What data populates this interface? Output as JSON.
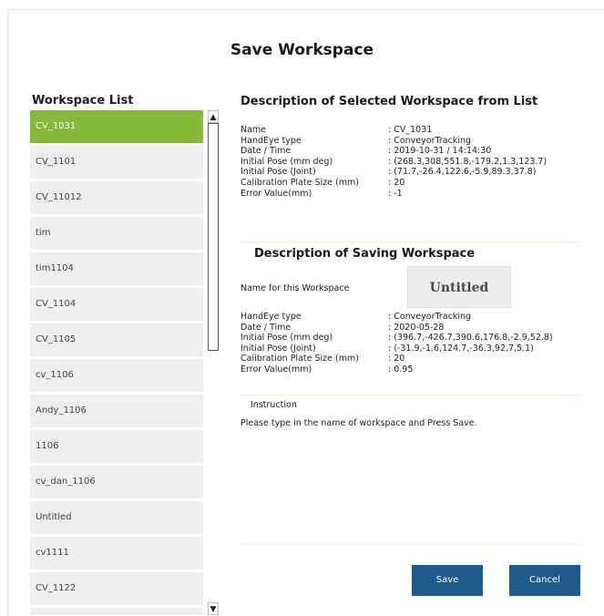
{
  "dialog": {
    "title": "Save Workspace"
  },
  "workspace_list": {
    "title": "Workspace List",
    "items": [
      {
        "label": "CV_1031",
        "selected": true
      },
      {
        "label": "CV_1101"
      },
      {
        "label": "CV_11012"
      },
      {
        "label": "tim"
      },
      {
        "label": "tim1104"
      },
      {
        "label": "CV_1104"
      },
      {
        "label": "CV_1105"
      },
      {
        "label": "cv_1106"
      },
      {
        "label": "Andy_1106"
      },
      {
        "label": "1106"
      },
      {
        "label": "cv_dan_1106"
      },
      {
        "label": "Untitled"
      },
      {
        "label": "cv1111"
      },
      {
        "label": "CV_1122"
      }
    ],
    "scroll_up_icon": "triangle-up",
    "scroll_down_icon": "triangle-down"
  },
  "selected_desc": {
    "title": "Description of Selected Workspace from List",
    "rows": [
      {
        "k": "Name",
        "v": ": CV_1031"
      },
      {
        "k": "HandEye type",
        "v": ": ConveyorTracking"
      },
      {
        "k": "Date / Time",
        "v": ": 2019-10-31 / 14:14:30"
      },
      {
        "k": "Initial Pose (mm deg)",
        "v": ": (268.3,308,551.8,-179.2,1.3,123.7)"
      },
      {
        "k": "Initial Pose (Joint)",
        "v": ": (71.7,-26.4,122.6,-5.9,89.3,37.8)"
      },
      {
        "k": "Calibration Plate Size (mm)",
        "v": ": 20"
      },
      {
        "k": "Error Value(mm)",
        "v": ": -1"
      }
    ]
  },
  "saving_desc": {
    "title": "Description of Saving Workspace",
    "name_label": "Name for this Workspace",
    "name_value": "Untitled",
    "rows": [
      {
        "k": "HandEye type",
        "v": ": ConveyorTracking"
      },
      {
        "k": "Date / Time",
        "v": ": 2020-05-28"
      },
      {
        "k": "Initial Pose (mm deg)",
        "v": ": (396.7,-426.7,390.6,176.8,-2.9,52.8)"
      },
      {
        "k": "Initial Pose (Joint)",
        "v": ": (-31.9,-1.6,124.7,-36.3,92.7,5.1)"
      },
      {
        "k": "Calibration Plate Size (mm)",
        "v": ": 20"
      },
      {
        "k": "Error Value(mm)",
        "v": ": 0.95"
      }
    ]
  },
  "instruction": {
    "label": "Instruction",
    "text": "Please type in the name of workspace and Press Save."
  },
  "buttons": {
    "save": "Save",
    "cancel": "Cancel"
  },
  "colors": {
    "selected": "#86b83a",
    "button": "#1f5a8c",
    "list_item": "#efefef"
  }
}
